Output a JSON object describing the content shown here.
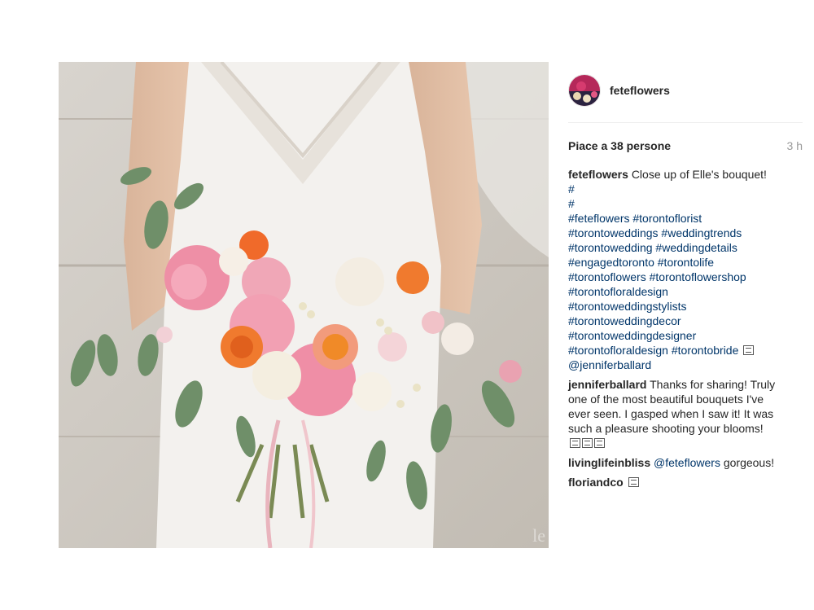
{
  "post": {
    "image_alt": "",
    "watermark": "le"
  },
  "author": {
    "username": "feteflowers",
    "avatar": "avatar-flowers"
  },
  "meta": {
    "likes": "Piace a 38 persone",
    "time": "3 h"
  },
  "caption": {
    "user": "feteflowers",
    "text": "Close up of Elle's bouquet!",
    "hash1": "#",
    "hash2": "#",
    "lines": [
      [
        "#feteflowers",
        "#torontoflorist"
      ],
      [
        "#torontoweddings",
        "#weddingtrends"
      ],
      [
        "#torontowedding",
        "#weddingdetails"
      ],
      [
        "#engagedtoronto",
        "#torontolife"
      ],
      [
        "#torontoflowers",
        "#torontoflowershop"
      ],
      [
        "#torontofloraldesign"
      ],
      [
        "#torontoweddingstylists"
      ],
      [
        "#torontoweddingdecor"
      ],
      [
        "#torontoweddingdesigner"
      ],
      [
        "#torontofloraldesign",
        "#torontobride"
      ]
    ],
    "mention": "@jenniferballard"
  },
  "comments": [
    {
      "user": "jenniferballard",
      "lines": [
        "Thanks for sharing! Truly",
        "one of the most beautiful bouquets I've",
        "ever seen. I gasped when I saw it! It was",
        "such a pleasure shooting your blooms!"
      ]
    },
    {
      "user": "livinglifeinbliss",
      "mention": "@feteflowers",
      "text": "gorgeous!"
    },
    {
      "user": "floriandco"
    }
  ],
  "colors": {
    "link": "#003569",
    "text": "#262626",
    "muted": "#999999"
  }
}
